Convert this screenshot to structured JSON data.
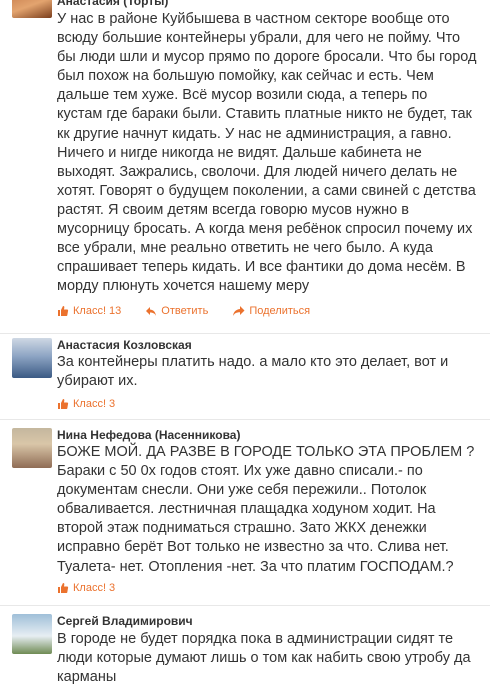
{
  "comments": [
    {
      "author": "Анастасия (Торты)",
      "text": "У нас в районе Куйбышева в частном секторе вообще ото\nвсюду большие контейнеры убрали, для чего не пойму. Что\nбы люди шли и мусор прямо по дороге бросали. Что бы город\nбыл похож на большую помойку, как сейчас и есть. Чем\nдальше тем хуже. Всё мусор возили сюда, а теперь по\nкустам где бараки были. Ставить платные никто не будет, так\nкк другие начнут кидать. У нас не администрация, а гавно.\nНичего и нигде никогда не видят. Дальше кабинета не\nвыходят. Зажрались, сволочи. Для людей ничего делать не\nхотят. Говорят о будущем поколении, а сами свиней с детства\nрастят. Я своим детям всегда говорю мусов нужно в\nмусорницу бросать. А когда меня ребёнок спросил почему их\nвсе убрали, мне реально ответить не чего было. А куда\nспрашивает теперь кидать. И все фантики до дома несём. В\nморду плюнуть хочется нашему меру",
      "like_label": "Класс! 13",
      "reply_label": "Ответить",
      "share_label": "Поделиться"
    },
    {
      "author": "Анастасия Козловская",
      "text": "За контейнеры платить надо. а мало кто это делает, вот и\nубирают их.",
      "like_label": "Класс! 3"
    },
    {
      "author": "Нина Нефедова (Насенникова)",
      "text": "БОЖЕ МОЙ. ДА РАЗВЕ В ГОРОДЕ ТОЛЬКО ЭТА ПРОБЛЕМ ?\nБараки с 50 0х годов стоят. Их уже давно списали.- по\nдокументам снесли. Они уже себя пережили.. Потолок\nобваливается. лестничная плащадка ходуном ходит. На\nвторой этаж подниматься страшно. Зато ЖКХ денежки\nисправно берёт  Вот  только не известно за что. Слива нет.\nТуалета- нет. Отопления -нет. За что платим ГОСПОДАМ.?",
      "like_label": "Класс! 3"
    },
    {
      "author": "Сергей Владимирович",
      "text": "В городе не будет порядка пока в администрации сидят те\nлюди которые думают лишь о том как набить свою утробу да\nкарманы"
    }
  ]
}
